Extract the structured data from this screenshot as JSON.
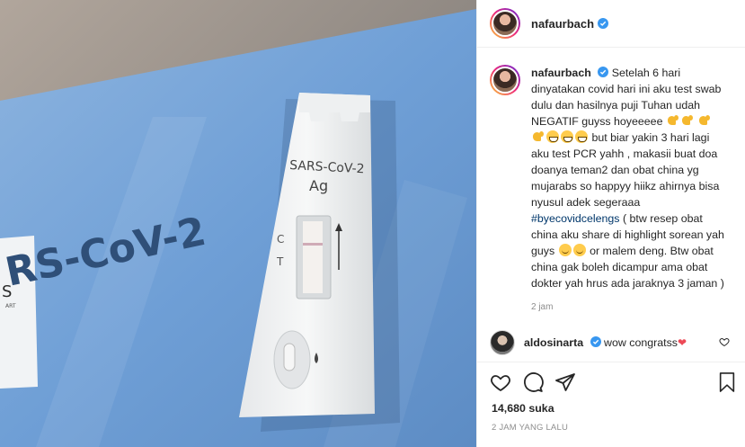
{
  "photo": {
    "box_text": "RS-CoV-2",
    "cassette_label_1": "SARS-CoV-2",
    "cassette_label_2": "Ag",
    "mark_c": "C",
    "mark_t": "T",
    "sticker_letters": "S",
    "sticker_letters_2": "ART"
  },
  "header": {
    "username": "nafaurbach",
    "verified_icon": "verified-badge-icon"
  },
  "caption": {
    "username": "nafaurbach",
    "text_1": "Setelah 6 hari dinyatakan covid hari ini aku test swab dulu dan hasilnya puji Tuhan udah NEGATIF guyss hoyeeeee",
    "text_2": "but biar yakin 3 hari lagi aku test PCR yahh , makasii buat doa doanya teman2 dan obat china yg mujarabs so happyy hiikz ahirnya bisa nyusul adek segeraaa",
    "hashtag": "#byecovidcelengs",
    "text_3": "( btw resep obat china aku share di highlight sorean yah guys",
    "text_4": "or malem deng. Btw obat china gak boleh dicampur ama obat dokter yah hrus ada jaraknya 3 jaman )",
    "time": "2 jam"
  },
  "comment": {
    "username": "aldosinarta",
    "text": "wow congratss"
  },
  "actions": {
    "likes": "14,680 suka",
    "post_time": "2 JAM YANG LALU"
  },
  "colors": {
    "link": "#00376b",
    "verified": "#3897f0",
    "heart": "#ed4956",
    "box_blue": "#6f9fd6"
  }
}
